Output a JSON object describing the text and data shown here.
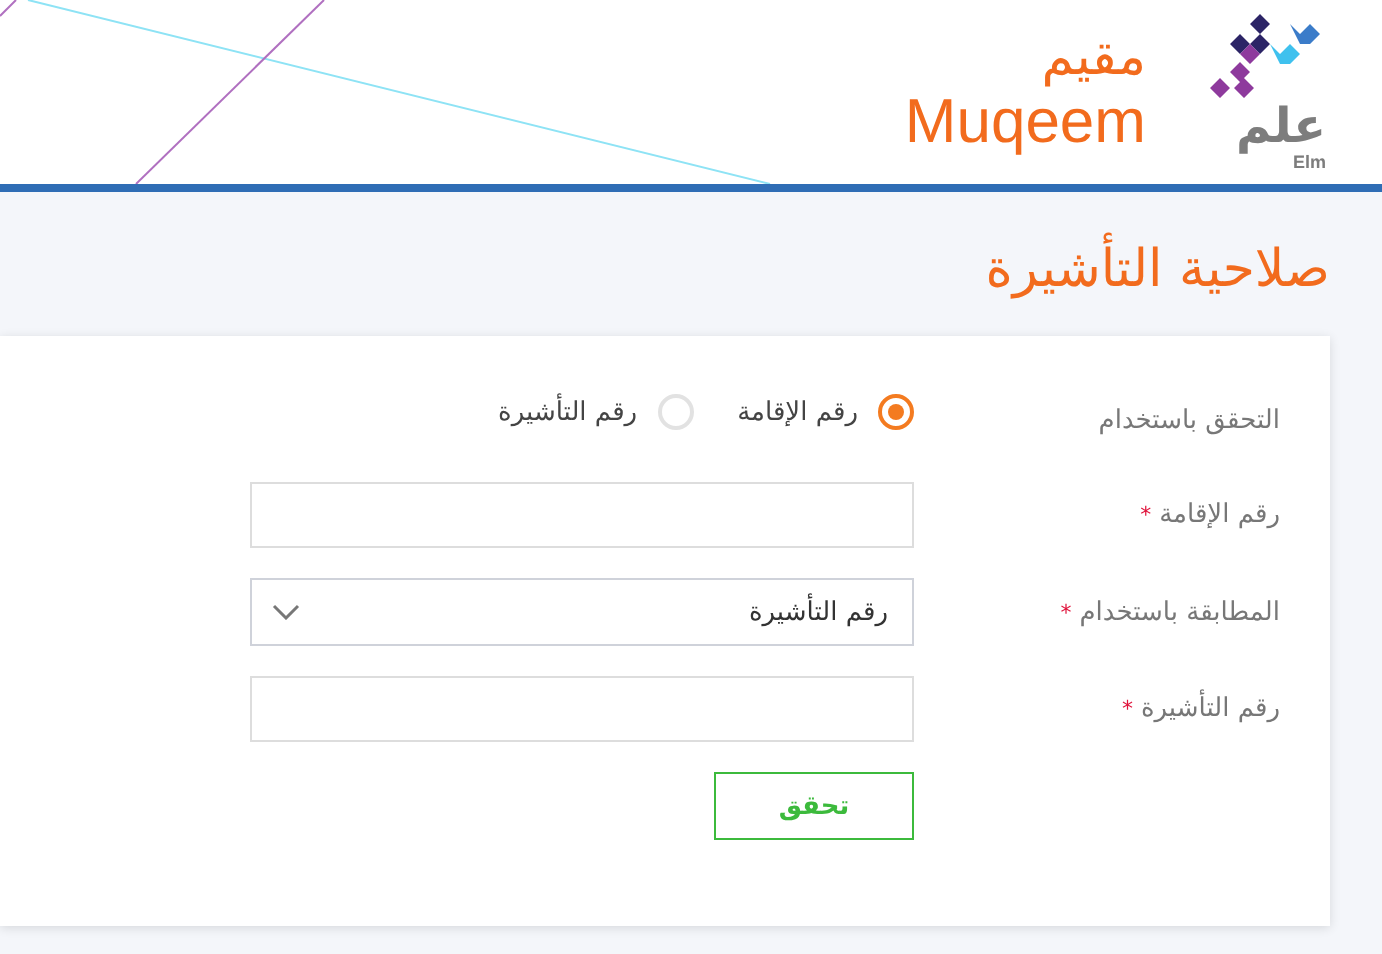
{
  "header": {
    "brand_arabic": "مقيم",
    "brand_latin": "Muqeem",
    "partner_arabic": "علم",
    "partner_latin": "Elm"
  },
  "page_title": "صلاحية التأشيرة",
  "form": {
    "verify_by": {
      "label": "التحقق باستخدام",
      "options": [
        {
          "label": "رقم الإقامة",
          "selected": true
        },
        {
          "label": "رقم التأشيرة",
          "selected": false
        }
      ]
    },
    "fields": [
      {
        "kind": "input",
        "label": "رقم الإقامة",
        "required_mark": "*"
      },
      {
        "kind": "select",
        "label": "المطابقة باستخدام",
        "required_mark": "*",
        "value": "رقم التأشيرة"
      },
      {
        "kind": "input",
        "label": "رقم التأشيرة",
        "required_mark": "*"
      }
    ],
    "submit": "تحقق"
  }
}
